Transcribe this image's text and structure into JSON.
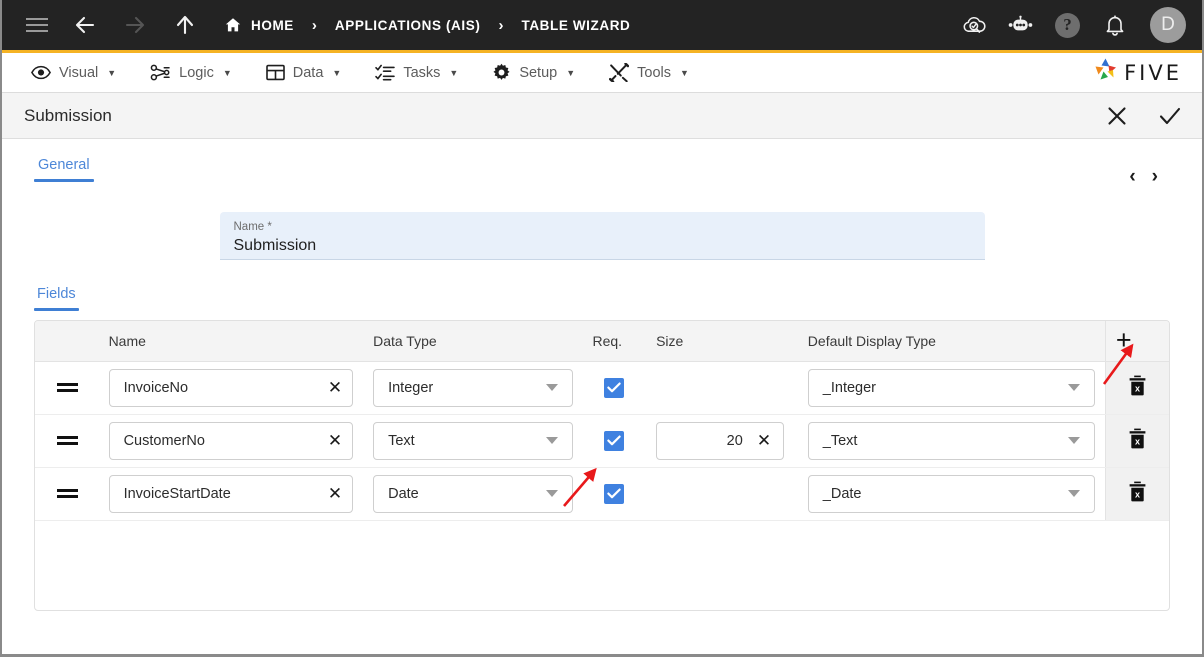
{
  "topbar": {
    "menu_icon": "hamburger-icon",
    "back_icon": "arrow-left-icon",
    "forward_icon": "arrow-right-icon",
    "up_icon": "arrow-up-icon",
    "breadcrumbs": [
      {
        "label": "HOME",
        "icon": "home-icon"
      },
      {
        "label": "APPLICATIONS (AIS)",
        "icon": ""
      },
      {
        "label": "TABLE WIZARD",
        "icon": ""
      }
    ],
    "separator": "›",
    "actions": [
      {
        "name": "cloud-search-icon",
        "label": ""
      },
      {
        "name": "chat-bot-icon",
        "label": ""
      },
      {
        "name": "help-icon",
        "label": "?"
      },
      {
        "name": "bell-icon",
        "label": ""
      }
    ],
    "avatar_initial": "D",
    "accent_color": "#f5b324",
    "background_color": "#232323"
  },
  "menubar": {
    "items": [
      {
        "label": "Visual",
        "icon": "eye-icon"
      },
      {
        "label": "Logic",
        "icon": "logic-nodes-icon"
      },
      {
        "label": "Data",
        "icon": "table-grid-icon"
      },
      {
        "label": "Tasks",
        "icon": "checklist-icon"
      },
      {
        "label": "Setup",
        "icon": "gear-icon"
      },
      {
        "label": "Tools",
        "icon": "tools-icon"
      }
    ],
    "caret": "▼",
    "logo_text": "FIVE"
  },
  "record_header": {
    "title": "Submission",
    "close_label": "✕",
    "confirm_label": "✓"
  },
  "tabs": {
    "general": "General",
    "prev_label": "‹",
    "next_label": "›"
  },
  "name_field": {
    "label": "Name *",
    "value": "Submission"
  },
  "fields_section": {
    "tab_label": "Fields",
    "columns": [
      "",
      "Name",
      "Data Type",
      "Req.",
      "Size",
      "Default Display Type",
      ""
    ],
    "add_label": "+",
    "rows": [
      {
        "handle": "drag-handle-icon",
        "name": "InvoiceNo",
        "name_clear": "✕",
        "data_type": "Integer",
        "required": true,
        "size": "",
        "size_clear": "",
        "default_display_type": "_Integer",
        "delete_label": "delete-row-icon"
      },
      {
        "handle": "drag-handle-icon",
        "name": "CustomerNo",
        "name_clear": "✕",
        "data_type": "Text",
        "required": true,
        "size": "20",
        "size_clear": "✕",
        "default_display_type": "_Text",
        "delete_label": "delete-row-icon"
      },
      {
        "handle": "drag-handle-icon",
        "name": "InvoiceStartDate",
        "name_clear": "✕",
        "data_type": "Date",
        "required": true,
        "size": "",
        "size_clear": "",
        "default_display_type": "_Date",
        "delete_label": "delete-row-icon"
      }
    ]
  },
  "annotations": {
    "arrow_color": "#e8191b",
    "arrows": [
      {
        "name": "arrow-pointing-to-add-button"
      },
      {
        "name": "arrow-pointing-to-required-checkbox"
      }
    ]
  },
  "colors": {
    "checkbox_blue": "#3f81e0",
    "tab_blue": "#3f7fd4",
    "name_field_bg": "#e8f0fa",
    "header_gray": "#f4f4f4"
  }
}
